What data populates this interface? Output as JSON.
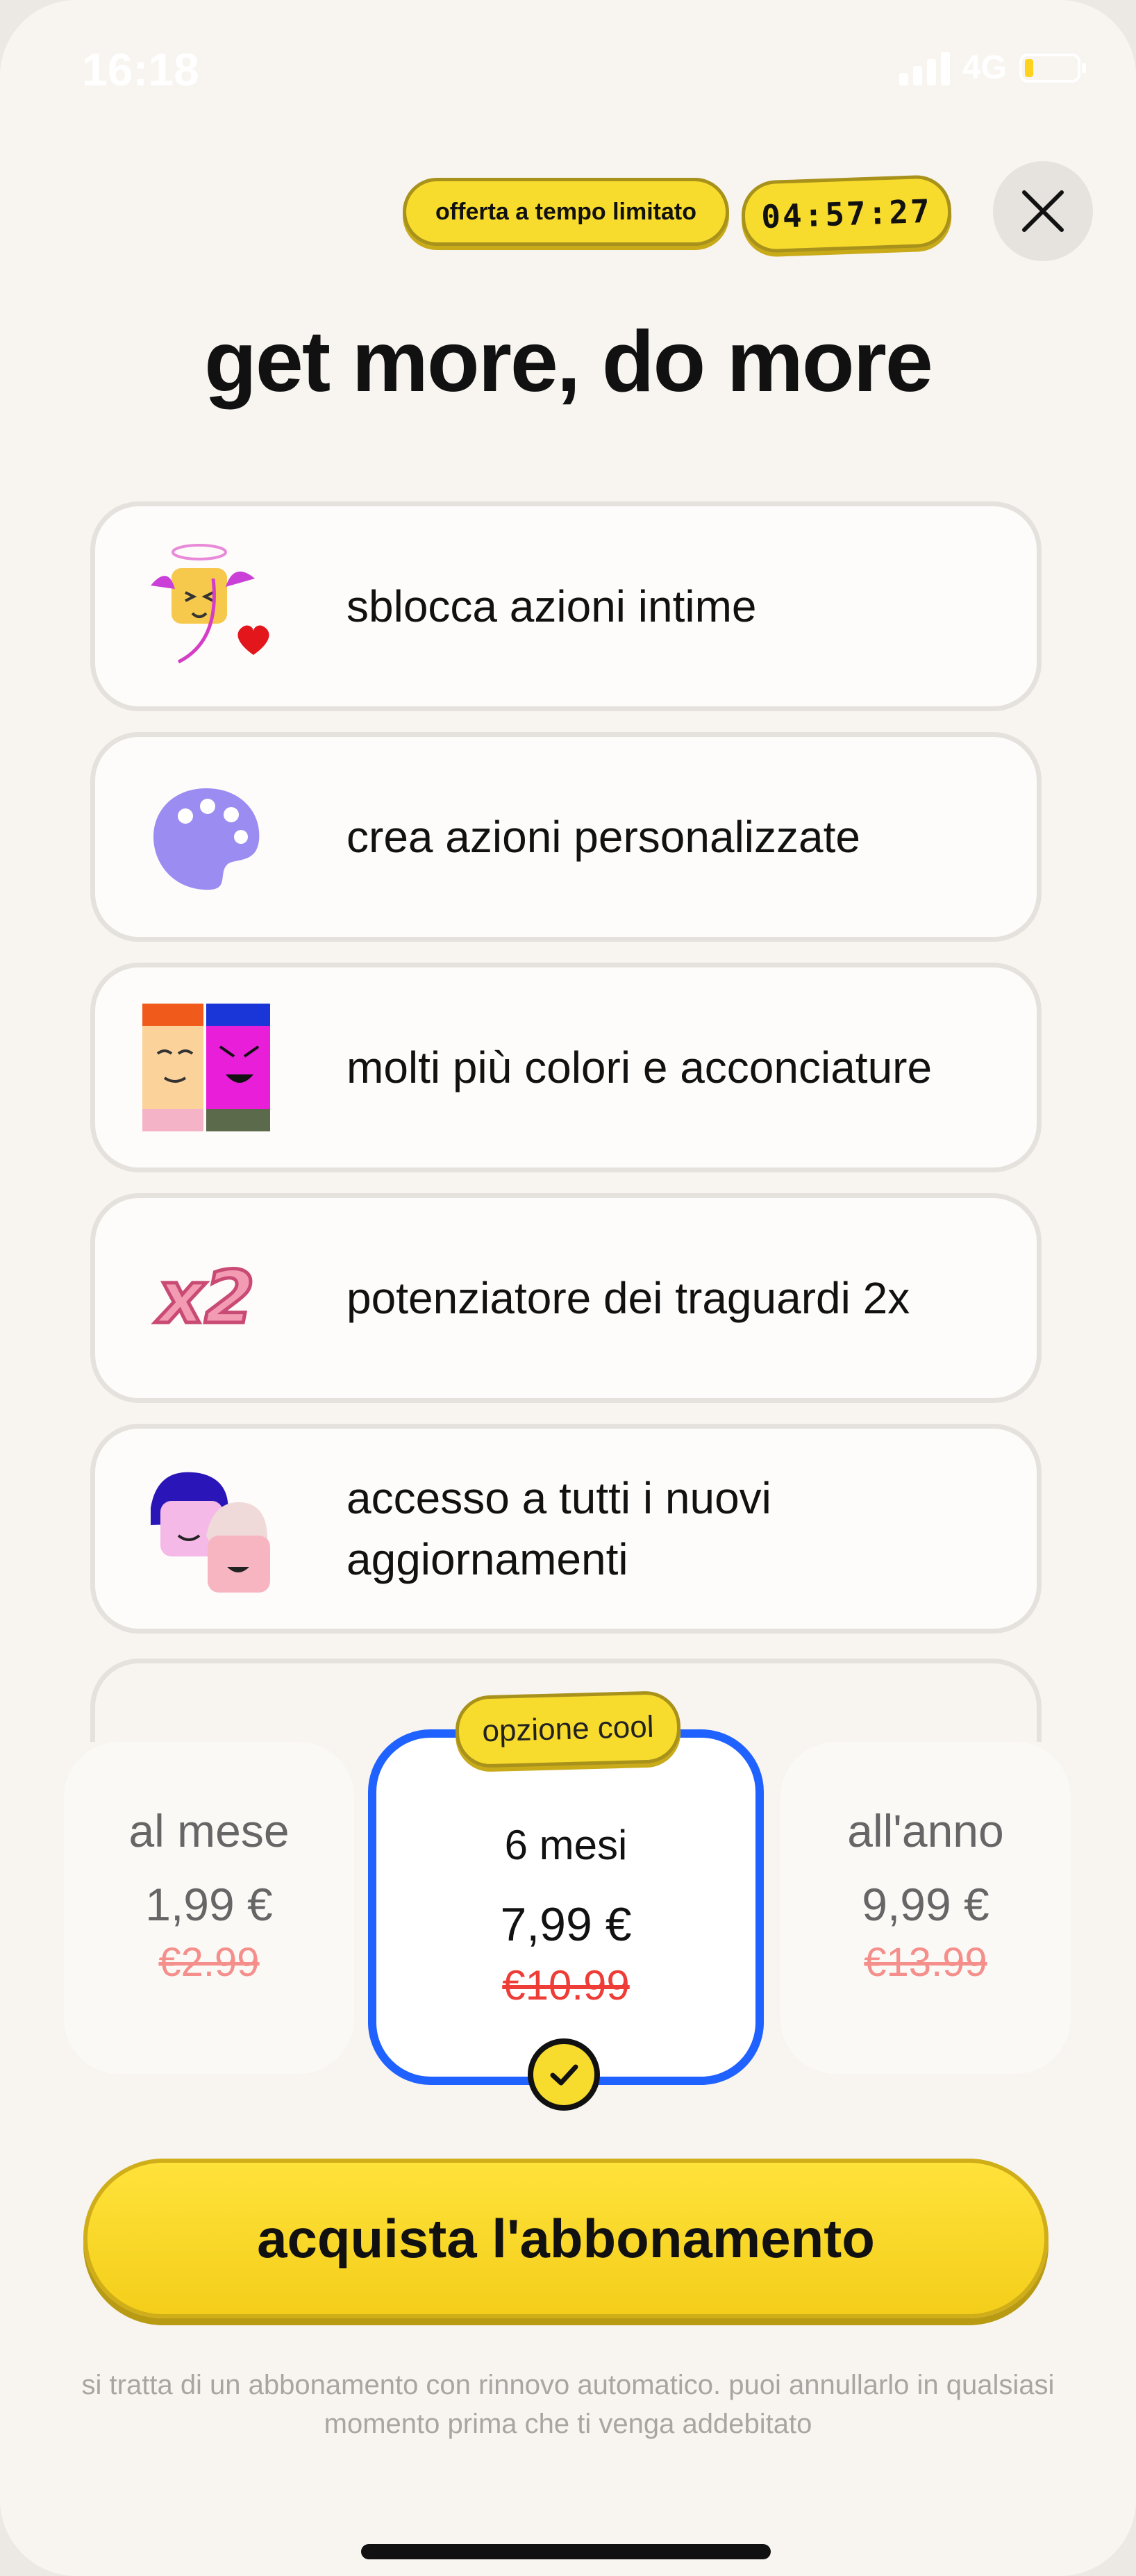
{
  "status_bar": {
    "time": "16:18",
    "network": "4G"
  },
  "header": {
    "offer_label": "offerta a tempo limitato",
    "timer": "04:57:27"
  },
  "title": "get more, do more",
  "features": [
    {
      "label": "sblocca azioni intime",
      "icon": "cupid-icon"
    },
    {
      "label": "crea azioni personalizzate",
      "icon": "palette-icon"
    },
    {
      "label": "molti più colori e acconciature",
      "icon": "faces-grid-icon"
    },
    {
      "label": "potenziatore dei traguardi 2x",
      "icon": "x2-icon"
    },
    {
      "label": "accesso a tutti i nuovi aggiornamenti",
      "icon": "avatars-icon"
    }
  ],
  "plans": [
    {
      "name": "al mese",
      "price": "1,99 €",
      "old_price": "€2.99",
      "selected": false
    },
    {
      "name": "6 mesi",
      "price": "7,99 €",
      "old_price": "€10.99",
      "selected": true,
      "badge": "opzione cool"
    },
    {
      "name": "all'anno",
      "price": "9,99 €",
      "old_price": "€13.99",
      "selected": false
    }
  ],
  "cta_label": "acquista l'abbonamento",
  "legal": "si tratta di un abbonamento con rinnovo automatico. puoi annullarlo in qualsiasi momento prima che ti venga addebitato",
  "colors": {
    "accent_yellow": "#f8dc2d",
    "selected_blue": "#1f62ff",
    "strike_red": "#ee3c37",
    "background": "#f8f5f1"
  }
}
